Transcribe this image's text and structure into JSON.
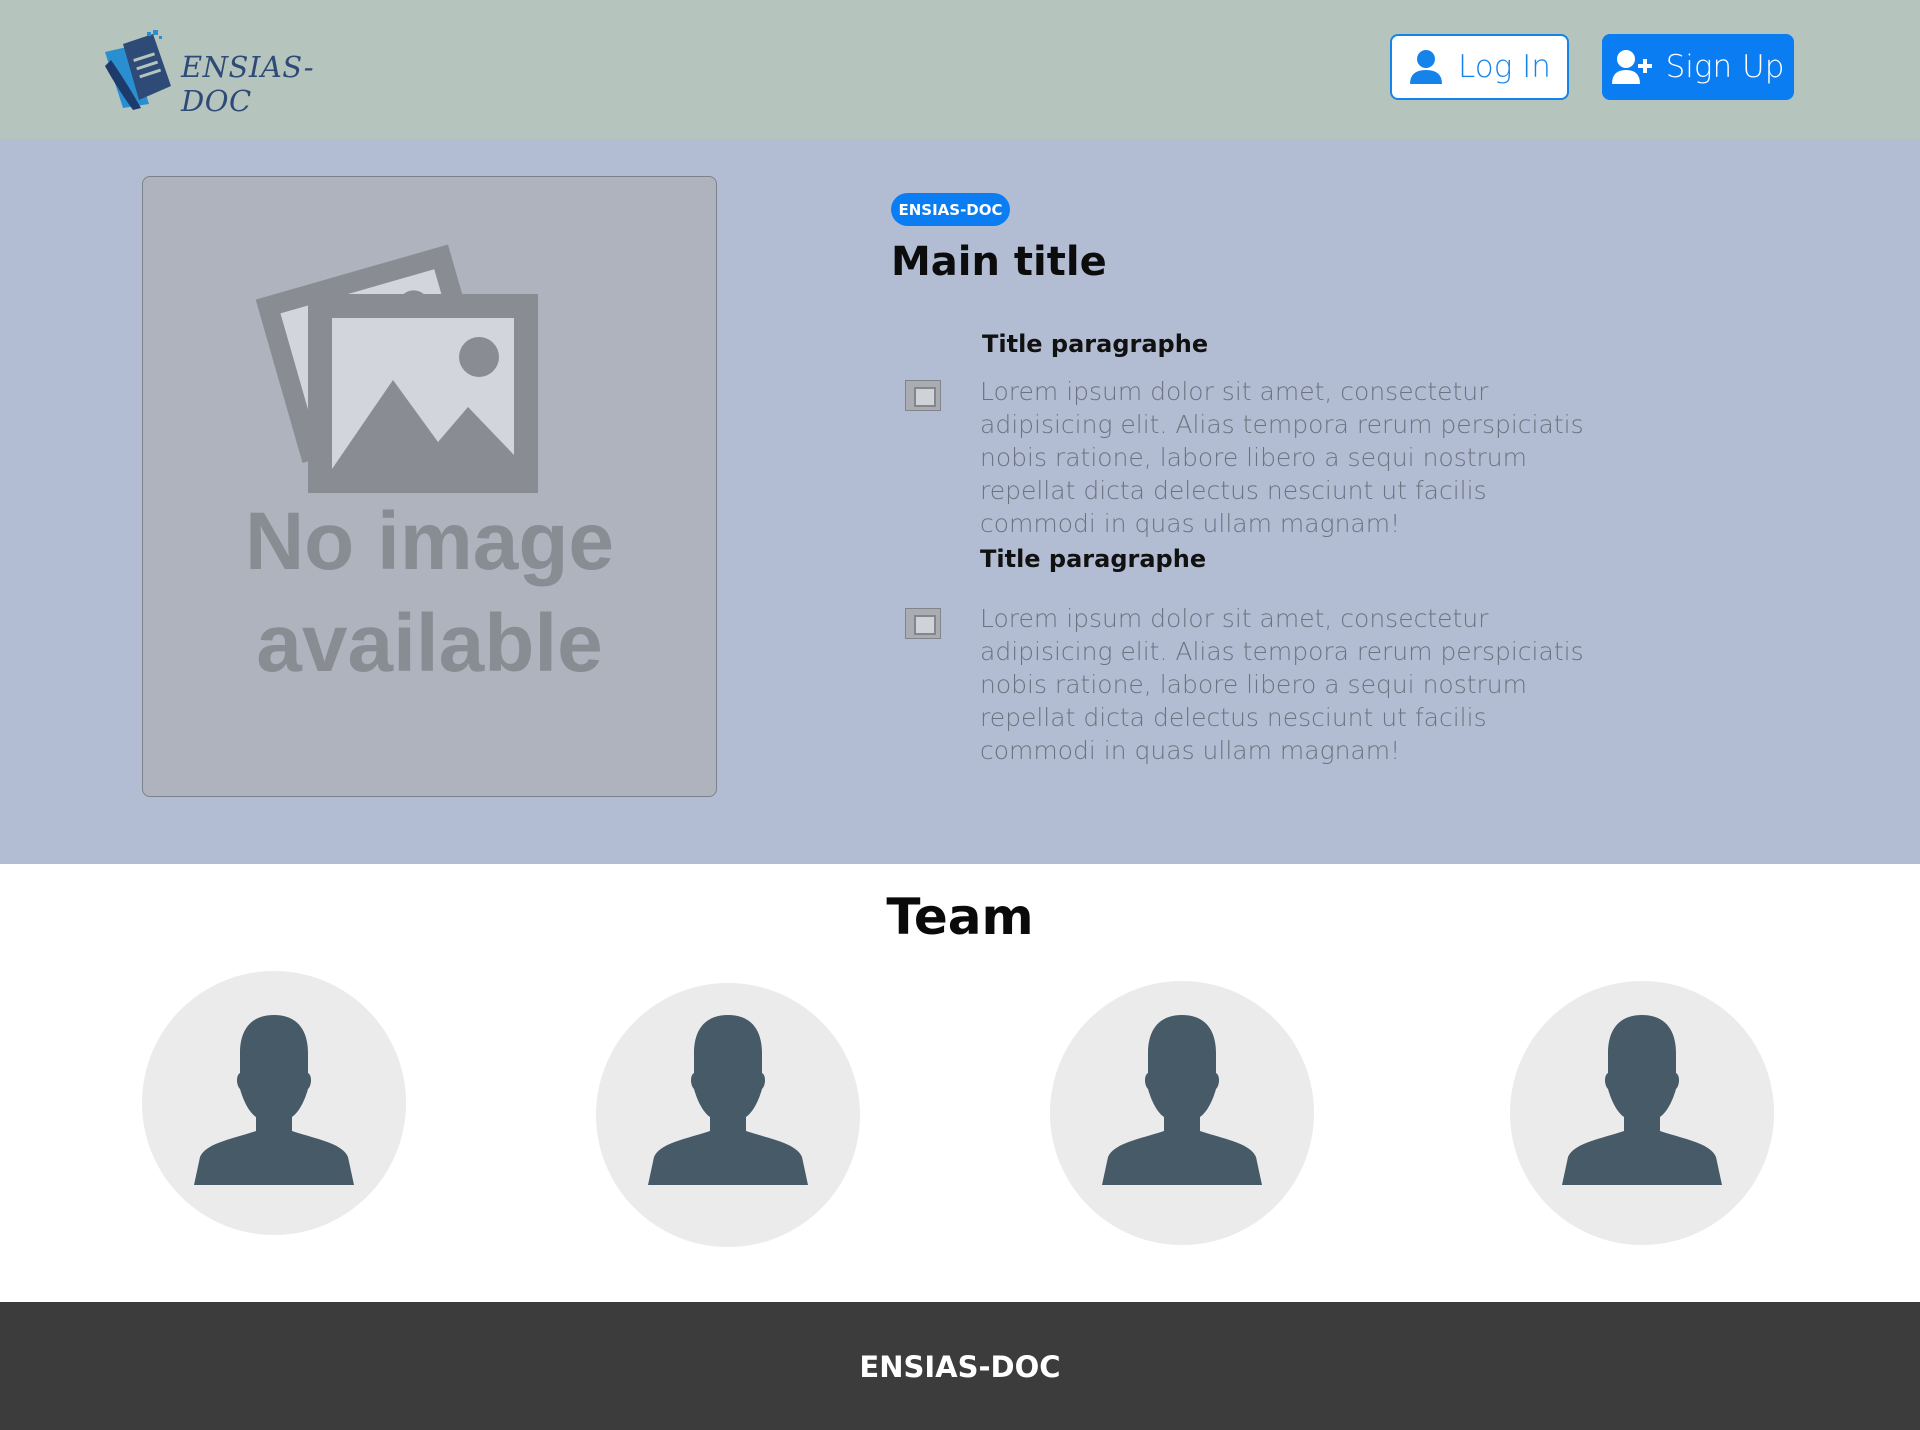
{
  "header": {
    "logo_text": "ENSIAS-DOC",
    "login_label": "Log In",
    "signup_label": "Sign Up"
  },
  "hero": {
    "placeholder_line1": "No image",
    "placeholder_line2": "available",
    "badge": "ENSIAS-DOC",
    "main_title": "Main title",
    "paragraphs": [
      {
        "title": "Title paragraphe",
        "text": "Lorem ipsum dolor sit amet, consectetur adipisicing elit. Alias tempora rerum perspiciatis nobis ratione, labore libero a sequi nostrum repellat dicta delectus nesciunt ut facilis commodi in quas ullam magnam!"
      },
      {
        "title": "Title paragraphe",
        "text": "Lorem ipsum dolor sit amet, consectetur adipisicing elit. Alias tempora rerum perspiciatis nobis ratione, labore libero a sequi nostrum repellat dicta delectus nesciunt ut facilis commodi in quas ullam magnam!"
      }
    ]
  },
  "team": {
    "title": "Team",
    "members": [
      {
        "icon": "person-silhouette-icon"
      },
      {
        "icon": "person-silhouette-icon"
      },
      {
        "icon": "person-silhouette-icon"
      },
      {
        "icon": "person-silhouette-icon"
      }
    ]
  },
  "footer": {
    "text": "ENSIAS-DOC"
  },
  "colors": {
    "header_bg": "#b5c4bd",
    "hero_bg": "#b2bdd3",
    "accent": "#0a7df2",
    "footer_bg": "#3c3c3c",
    "avatar_fg": "#475a67"
  }
}
